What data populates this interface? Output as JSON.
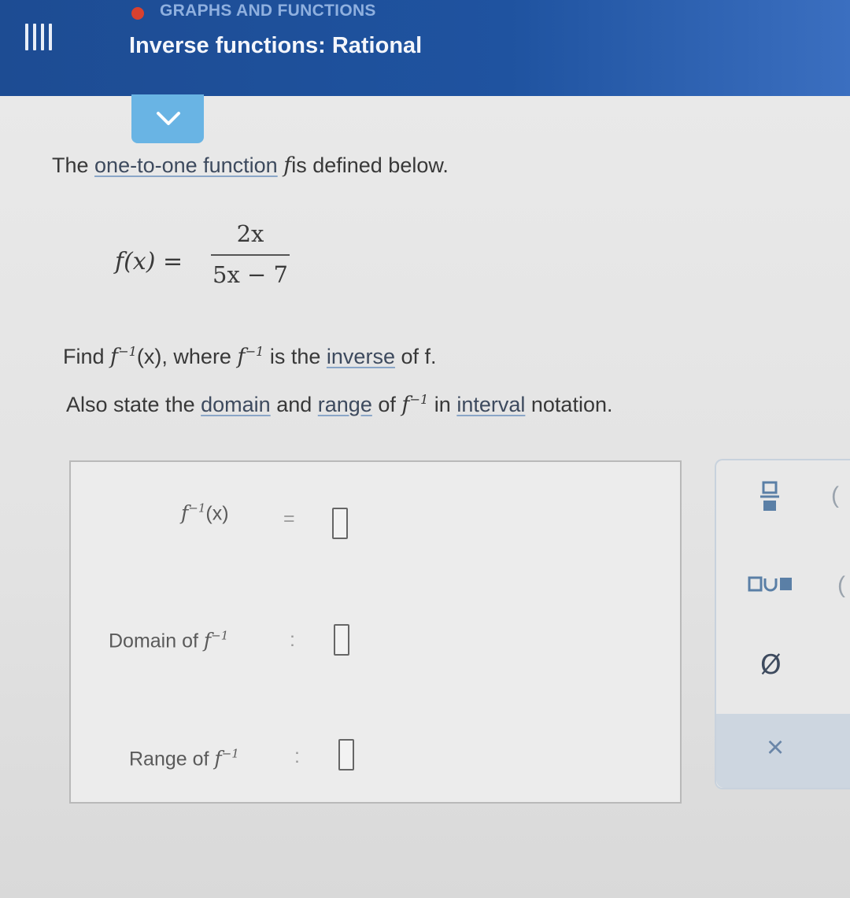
{
  "header": {
    "category": "GRAPHS AND FUNCTIONS",
    "title": "Inverse functions: Rational"
  },
  "problem": {
    "intro_before": "The ",
    "intro_link": "one-to-one function",
    "intro_f": "f",
    "intro_after": "is defined below.",
    "lhs": "f(x) =",
    "numerator": "2x",
    "denominator": "5x − 7",
    "find_word": "Find",
    "find_arg": "(x), where",
    "is_the": "is the",
    "inverse_link": "inverse",
    "of_f": "of f.",
    "also_text": "Also state the",
    "domain_link": "domain",
    "and_text": "and",
    "range_link": "range",
    "of_text": "of",
    "in_text": "in",
    "interval_link": "interval",
    "notation_text": "notation."
  },
  "answer": {
    "inverse_label": "(x)",
    "equals": "=",
    "domain_label": "Domain of",
    "range_label": "Range of",
    "colon": ":"
  },
  "toolbar": {
    "fraction_tool": "fraction-icon",
    "union_tool": "union-icon",
    "empty_set_symbol": "Ø",
    "clear_symbol": "×"
  }
}
